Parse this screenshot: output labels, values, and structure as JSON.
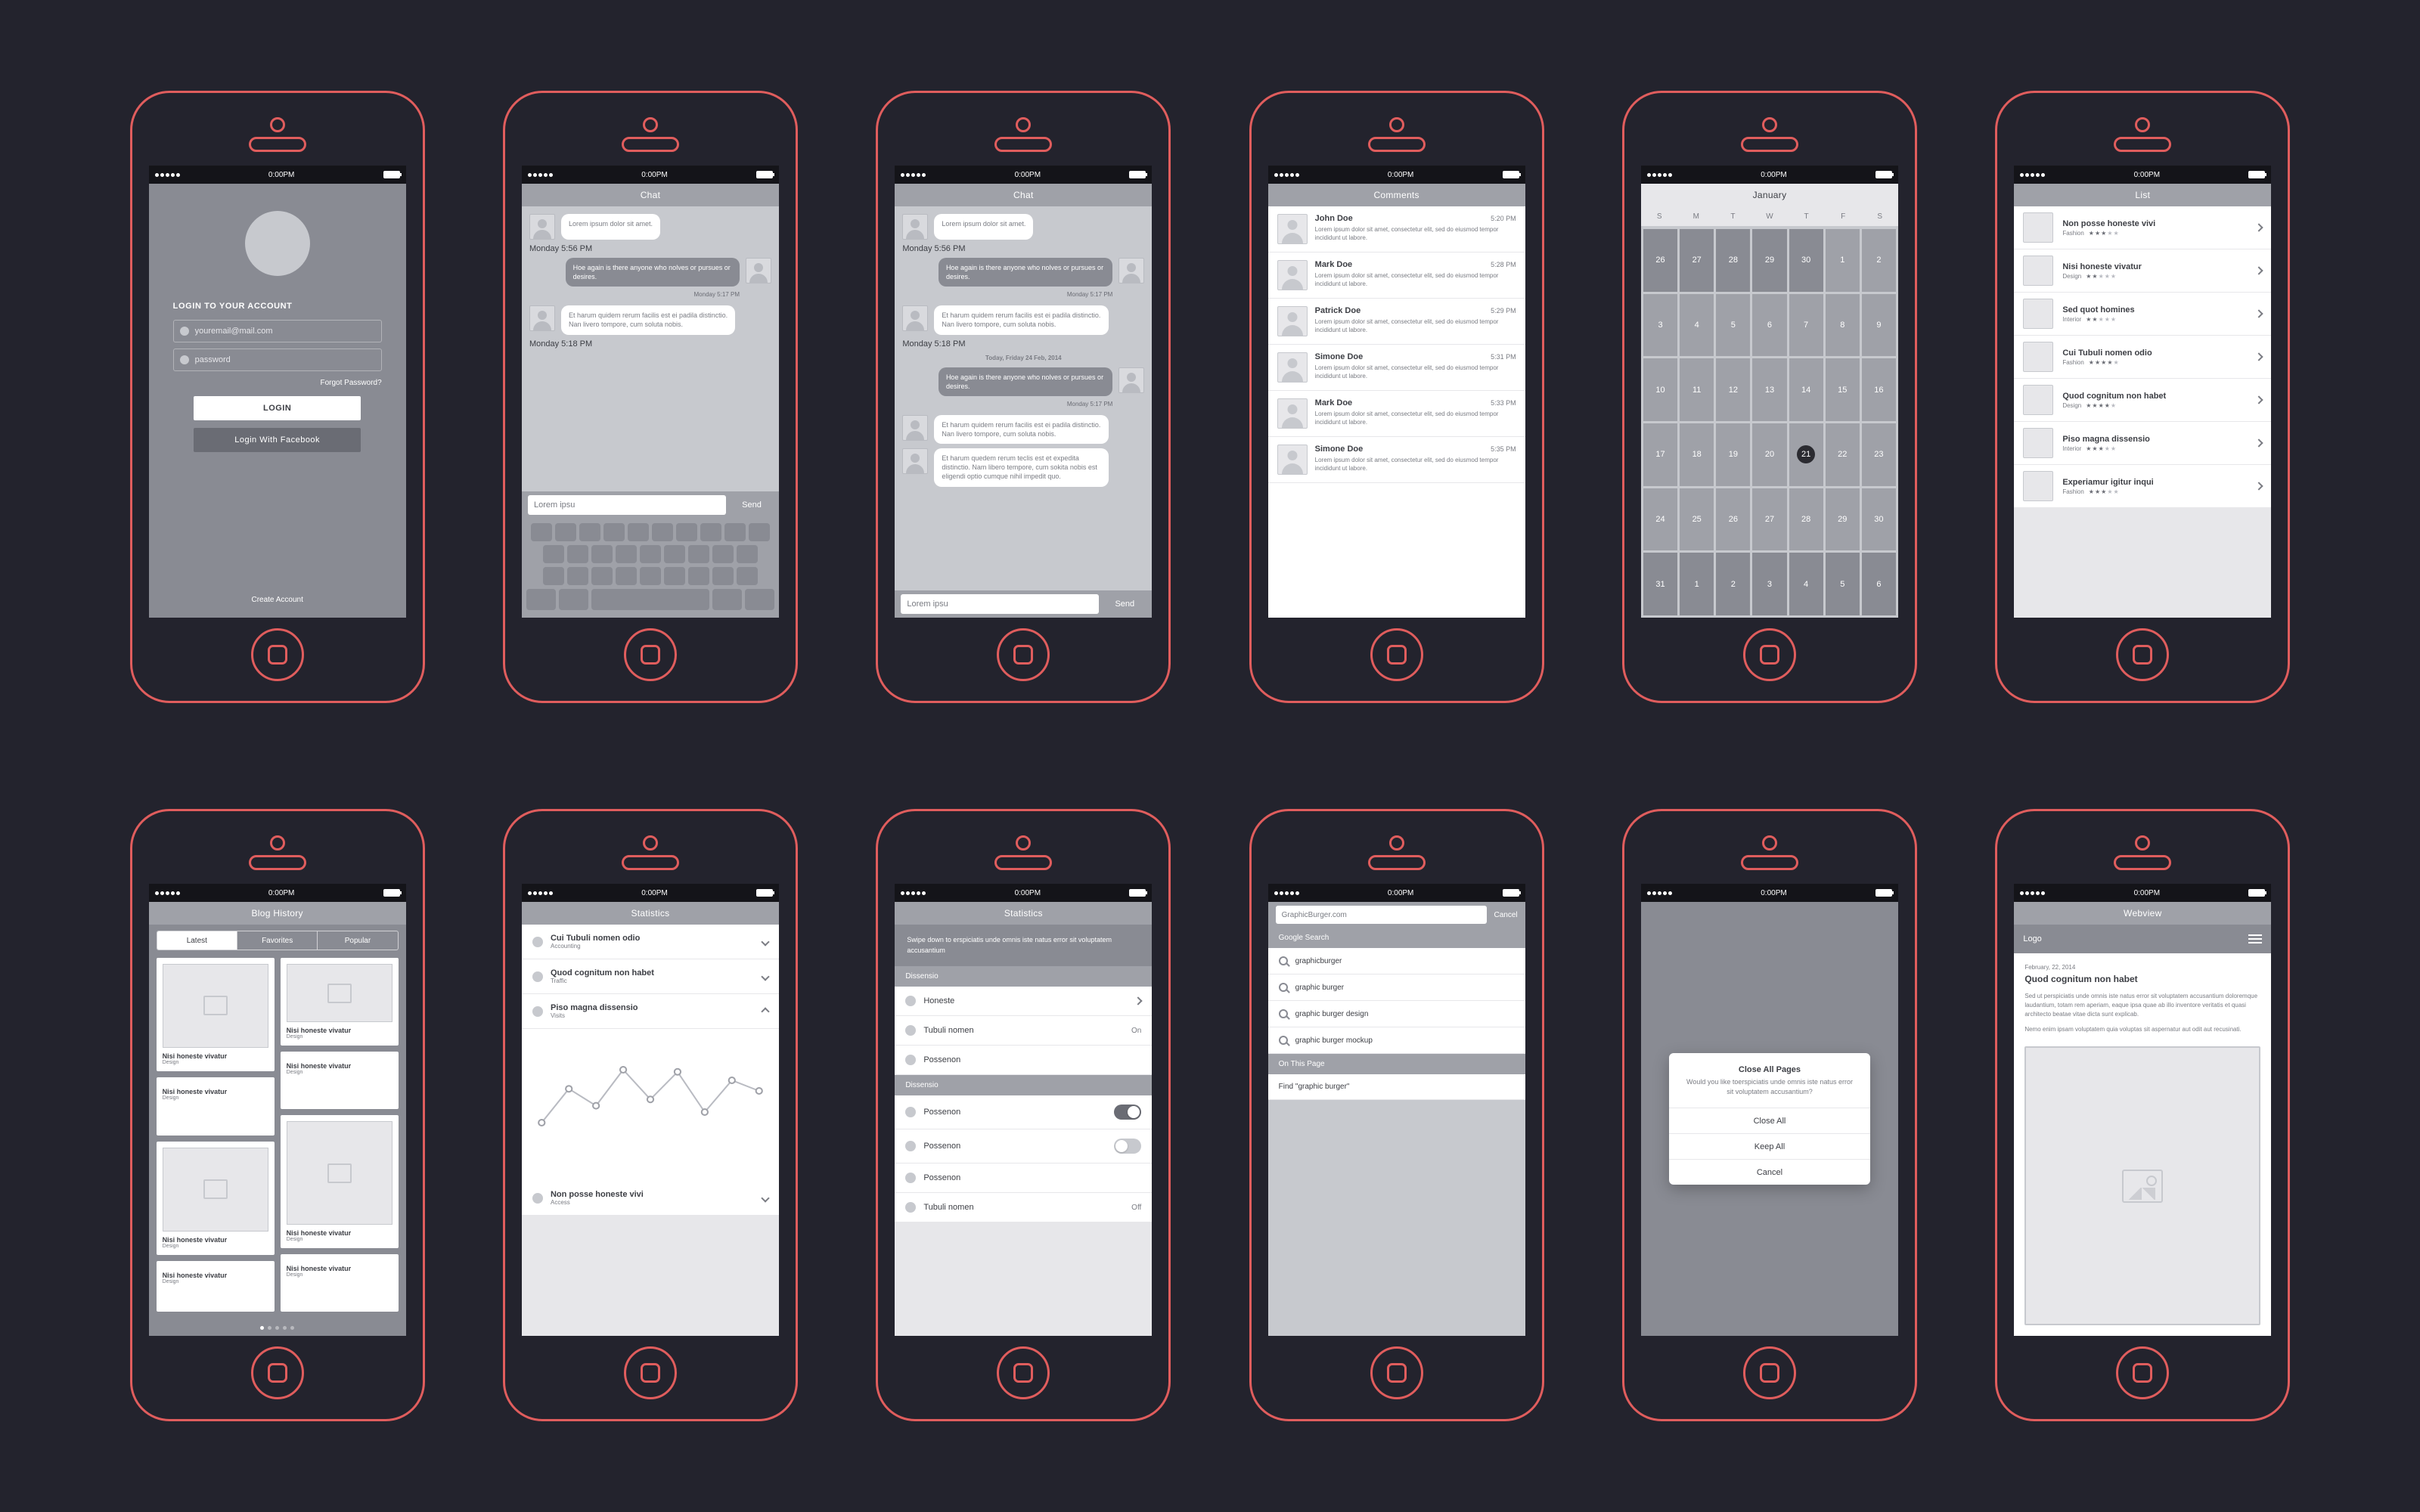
{
  "status": {
    "time": "0:00PM"
  },
  "login": {
    "title": "LOGIN TO YOUR ACCOUNT",
    "email_placeholder": "youremail@mail.com",
    "password_placeholder": "password",
    "forgot": "Forgot Password?",
    "login_btn": "LOGIN",
    "fb_btn": "Login With Facebook",
    "create": "Create Account"
  },
  "chat": {
    "title": "Chat",
    "input": "Lorem ipsu",
    "send": "Send",
    "day": "Today, Friday 24 Feb, 2014",
    "msgs": [
      {
        "side": "left",
        "text": "Lorem ipsum dolor sit amet.",
        "ts": "Monday 5:56 PM",
        "style": "white"
      },
      {
        "side": "right",
        "text": "Hoe again is there anyone who nolves or pursues or desires.",
        "ts": "Monday 5:17 PM",
        "style": "grey"
      },
      {
        "side": "left",
        "text": "Et harum quidem rerum facilis est ei padila distinctio. Nan livero tompore, cum soluta nobis.",
        "ts": "Monday 5:18 PM",
        "style": "white"
      }
    ],
    "msgs_extended": [
      {
        "side": "right",
        "text": "Hoe again is there anyone who nolves or pursues or desires.",
        "ts": "Monday 5:17 PM",
        "style": "grey"
      },
      {
        "side": "left",
        "text": "Et harum quidem rerum facilis est ei padila distinctio. Nan livero tompore, cum soluta nobis.",
        "ts": "",
        "style": "white"
      },
      {
        "side": "left",
        "text": "Et harum quedem rerum teclis est et expedita distinctio. Nam libero tempore, cum sokita nobis est eligendi optio cumque nihil impedit quo.",
        "ts": "",
        "style": "white"
      }
    ]
  },
  "comments": {
    "title": "Comments",
    "lorem": "Lorem ipsum dolor sit amet, consectetur elit, sed do eiusmod tempor incididunt ut labore.",
    "items": [
      {
        "name": "John Doe",
        "time": "5:20 PM"
      },
      {
        "name": "Mark Doe",
        "time": "5:28 PM"
      },
      {
        "name": "Patrick Doe",
        "time": "5:29 PM"
      },
      {
        "name": "Simone Doe",
        "time": "5:31 PM"
      },
      {
        "name": "Mark Doe",
        "time": "5:33 PM"
      },
      {
        "name": "Simone Doe",
        "time": "5:35 PM"
      }
    ]
  },
  "calendar": {
    "title": "January",
    "dow": [
      "S",
      "M",
      "T",
      "W",
      "T",
      "F",
      "S"
    ],
    "days": [
      {
        "n": 26,
        "out": true
      },
      {
        "n": 27,
        "out": true
      },
      {
        "n": 28,
        "out": true
      },
      {
        "n": 29,
        "out": true
      },
      {
        "n": 30,
        "out": true
      },
      {
        "n": 1
      },
      {
        "n": 2
      },
      {
        "n": 3
      },
      {
        "n": 4
      },
      {
        "n": 5
      },
      {
        "n": 6
      },
      {
        "n": 7
      },
      {
        "n": 8
      },
      {
        "n": 9
      },
      {
        "n": 10
      },
      {
        "n": 11
      },
      {
        "n": 12
      },
      {
        "n": 13
      },
      {
        "n": 14
      },
      {
        "n": 15
      },
      {
        "n": 16
      },
      {
        "n": 17
      },
      {
        "n": 18
      },
      {
        "n": 19
      },
      {
        "n": 20
      },
      {
        "n": 21,
        "today": true
      },
      {
        "n": 22
      },
      {
        "n": 23
      },
      {
        "n": 24
      },
      {
        "n": 25
      },
      {
        "n": 26
      },
      {
        "n": 27
      },
      {
        "n": 28
      },
      {
        "n": 29
      },
      {
        "n": 30
      },
      {
        "n": 31,
        "out": true
      },
      {
        "n": 1,
        "out": true
      },
      {
        "n": 2,
        "out": true
      },
      {
        "n": 3,
        "out": true
      },
      {
        "n": 4,
        "out": true
      },
      {
        "n": 5,
        "out": true
      },
      {
        "n": 6,
        "out": true
      }
    ]
  },
  "list": {
    "title": "List",
    "items": [
      {
        "title": "Non posse honeste vivi",
        "cat": "Fashion",
        "stars": 3
      },
      {
        "title": "Nisi honeste vivatur",
        "cat": "Design",
        "stars": 2
      },
      {
        "title": "Sed quot homines",
        "cat": "Interior",
        "stars": 2
      },
      {
        "title": "Cui Tubuli nomen odio",
        "cat": "Fashion",
        "stars": 4
      },
      {
        "title": "Quod cognitum non habet",
        "cat": "Design",
        "stars": 4
      },
      {
        "title": "Piso magna dissensio",
        "cat": "Interior",
        "stars": 3
      },
      {
        "title": "Experiamur igitur inqui",
        "cat": "Fashion",
        "stars": 3
      }
    ]
  },
  "blog": {
    "title": "Blog History",
    "tabs": [
      "Latest",
      "Favorites",
      "Popular"
    ],
    "card_title": "Nisi honeste vivatur",
    "card_cat": "Design"
  },
  "statsA": {
    "title": "Statistics",
    "items": [
      {
        "title": "Cui Tubuli nomen odio",
        "sub": "Accounting",
        "dir": "down"
      },
      {
        "title": "Quod cognitum non habet",
        "sub": "Traffic",
        "dir": "down"
      },
      {
        "title": "Piso magna dissensio",
        "sub": "Visits",
        "dir": "up"
      },
      {
        "title": "Non posse honeste vivi",
        "sub": "Access",
        "dir": "down"
      }
    ]
  },
  "statsB": {
    "title": "Statistics",
    "note": "Swipe down to erspiciatis unde omnis iste natus error sit voluptatem accusantium",
    "sec1": "Dissensio",
    "sec2": "Dissensio",
    "rows1": [
      {
        "label": "Honeste",
        "type": "link"
      },
      {
        "label": "Tubuli nomen",
        "type": "value",
        "value": "On"
      },
      {
        "label": "Possenon",
        "type": "plain"
      }
    ],
    "rows2": [
      {
        "label": "Possenon",
        "type": "toggle",
        "on": true
      },
      {
        "label": "Possenon",
        "type": "toggle",
        "on": false
      },
      {
        "label": "Possenon",
        "type": "plain"
      },
      {
        "label": "Tubuli nomen",
        "type": "value",
        "value": "Off"
      }
    ]
  },
  "search": {
    "value": "GraphicBurger.com",
    "cancel": "Cancel",
    "sec1": "Google Search",
    "sec2": "On This Page",
    "suggestions": [
      "graphicburger",
      "graphic burger",
      "graphic burger design",
      "graphic burger mockup"
    ],
    "find": "Find \"graphic burger\""
  },
  "dialog": {
    "title": "Close All Pages",
    "msg": "Would you like toerspiciatis unde omnis iste natus error sit voluptatem accusantium?",
    "btns": [
      "Close All",
      "Keep All",
      "Cancel"
    ]
  },
  "webview": {
    "title": "Webview",
    "logo": "Logo",
    "date": "February, 22, 2014",
    "headline": "Quod cognitum non habet",
    "p1": "Sed ut perspiciatis unde omnis iste natus error sit voluptatem accusantium doloremque laudantium, totam rem aperiam, eaque ipsa quae ab illo inventore veritatis et quasi architecto beatae vitae dicta sunt explicab.",
    "p2": "Nemo enim ipsam voluptatem quia voluptas sit aspernatur aut odit aut recusinati."
  },
  "chart_data": {
    "type": "line",
    "x": [
      0,
      1,
      2,
      3,
      4,
      5,
      6,
      7,
      8
    ],
    "values": [
      30,
      62,
      46,
      80,
      52,
      78,
      40,
      70,
      60
    ],
    "ylim": [
      0,
      100
    ],
    "xlabel": "",
    "ylabel": "",
    "title": ""
  }
}
